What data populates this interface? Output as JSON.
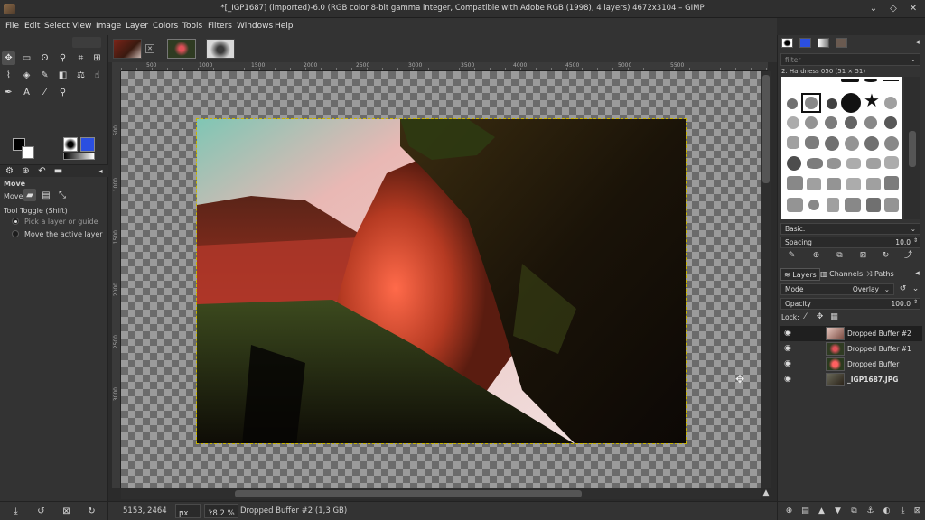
{
  "window": {
    "title": "*[_IGP1687] (imported)-6.0 (RGB color 8-bit gamma integer, Compatible with Adobe RGB (1998), 4 layers) 4672x3104 – GIMP"
  },
  "menu": [
    "File",
    "Edit",
    "Select",
    "View",
    "Image",
    "Layer",
    "Colors",
    "Tools",
    "Filters",
    "Windows",
    "Help"
  ],
  "tool_options": {
    "title": "Move",
    "move_label": "Move:",
    "toggle_label": "Tool Toggle  (Shift)",
    "option_pick": "Pick a layer or guide",
    "option_move_active": "Move the active layer"
  },
  "rulers": {
    "top_ticks": [
      "500",
      "1000",
      "1500",
      "2000",
      "2500",
      "3000",
      "3500",
      "4000",
      "4500",
      "5000",
      "5500"
    ],
    "left_ticks": [
      "500",
      "1000",
      "1500",
      "2000",
      "2500",
      "3000"
    ]
  },
  "statusbar": {
    "coords": "5153, 2464",
    "unit": "px",
    "zoom": "18.2 %",
    "message": "Dropped Buffer #2 (1,3 GB)"
  },
  "brushes": {
    "filter_placeholder": "filter",
    "selected_brush": "2. Hardness 050 (51 × 51)",
    "preset": "Basic.",
    "spacing_label": "Spacing",
    "spacing_value": "10.0"
  },
  "layers_panel": {
    "tabs": [
      "Layers",
      "Channels",
      "Paths"
    ],
    "mode_label": "Mode",
    "mode_value": "Overlay",
    "opacity_label": "Opacity",
    "opacity_value": "100.0",
    "lock_label": "Lock:",
    "layers": [
      {
        "name": "Dropped Buffer #2",
        "selected": true
      },
      {
        "name": "Dropped Buffer #1",
        "selected": false
      },
      {
        "name": "Dropped Buffer",
        "selected": false
      },
      {
        "name": "_IGP1687.JPG",
        "selected": false
      }
    ]
  },
  "colors": {
    "accent_pattern": "#2b4fe0",
    "selection_border": "#c8b400"
  }
}
